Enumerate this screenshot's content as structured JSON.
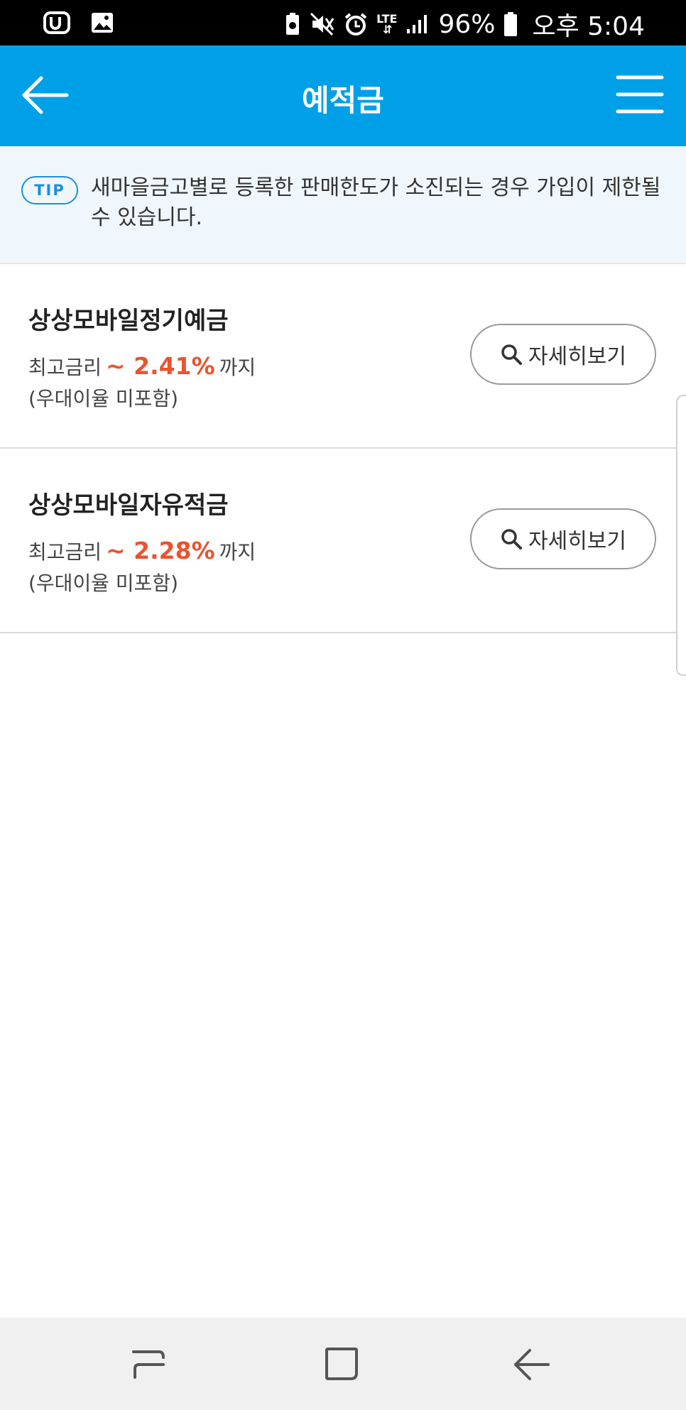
{
  "status_bar": {
    "battery": "96%",
    "time": "오후 5:04",
    "network": "LTE",
    "icons": [
      "u-plus-icon",
      "image-icon",
      "battery-saver-icon",
      "mute-icon",
      "alarm-icon",
      "lte-icon",
      "signal-icon",
      "battery-icon"
    ]
  },
  "app_bar": {
    "title": "예적금",
    "back_icon": "back-arrow-icon",
    "menu_icon": "hamburger-menu-icon",
    "color": "#00a0e8"
  },
  "tip": {
    "badge": "TIP",
    "text": "새마을금고별로 등록한 판매한도가 소진되는 경우 가입이 제한될 수 있습니다."
  },
  "products": [
    {
      "name": "상상모바일정기예금",
      "rate_prefix": "최고금리",
      "rate_value": "~ 2.41%",
      "rate_suffix": "까지",
      "note": "(우대이율 미포함)",
      "button_label": "자세히보기"
    },
    {
      "name": "상상모바일자유적금",
      "rate_prefix": "최고금리",
      "rate_value": "~ 2.28%",
      "rate_suffix": "까지",
      "note": "(우대이율 미포함)",
      "button_label": "자세히보기"
    }
  ],
  "colors": {
    "accent": "#00a0e8",
    "rate": "#e8542f",
    "tip": "#1b8fdc"
  },
  "nav_bar": {
    "icons": [
      "recent-apps-icon",
      "home-icon",
      "back-icon"
    ]
  }
}
